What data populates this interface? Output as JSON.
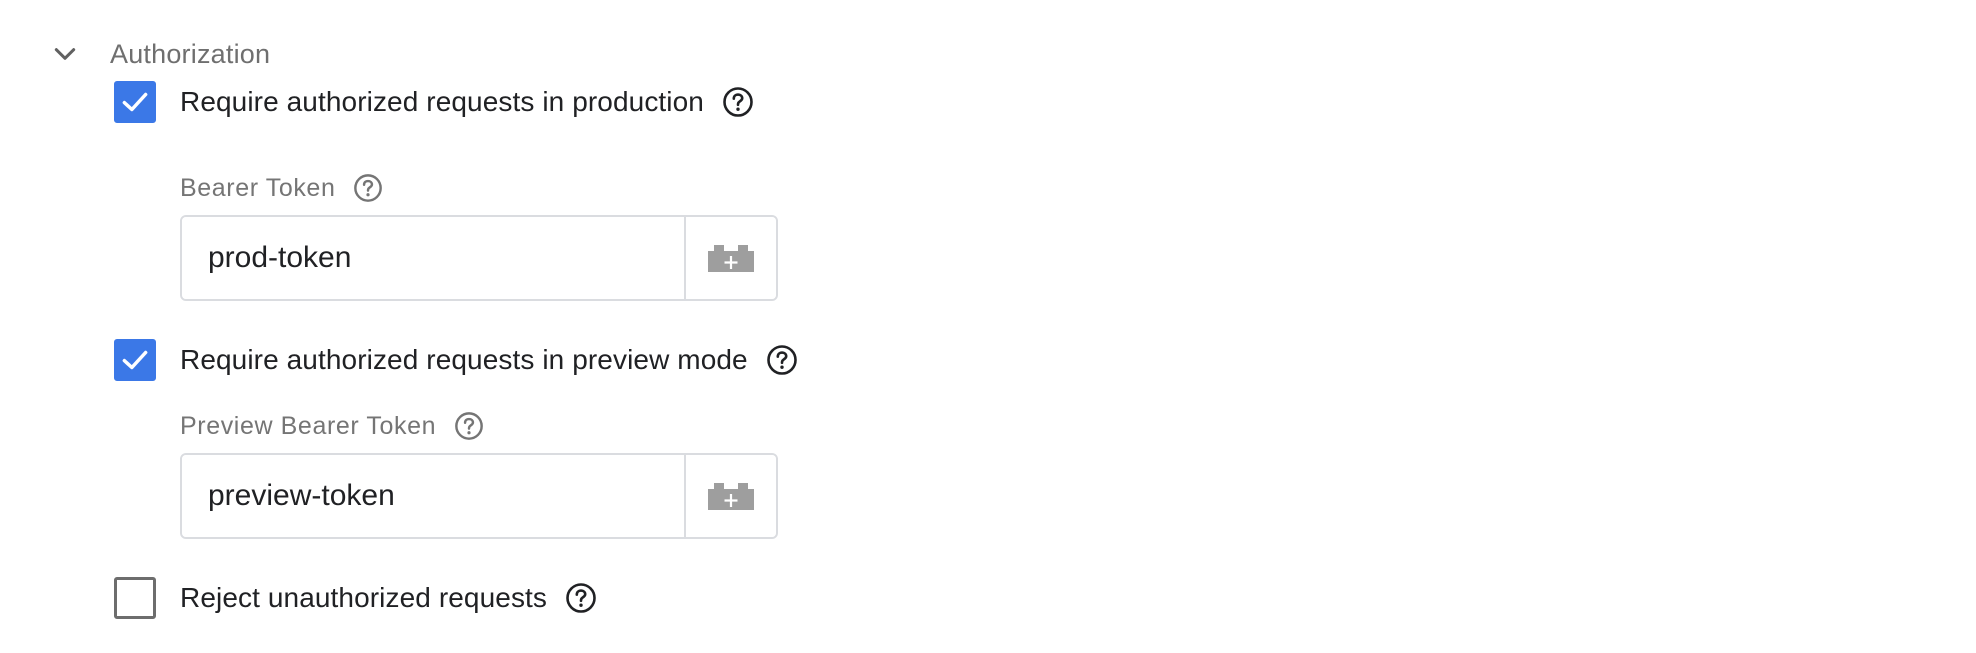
{
  "section": {
    "title": "Authorization",
    "expanded": true,
    "toggle_icon": "chevron-down-icon"
  },
  "options": {
    "production": {
      "label": "Require authorized requests in production",
      "checked": true,
      "field": {
        "label": "Bearer Token",
        "value": "prod-token"
      }
    },
    "preview": {
      "label": "Require authorized requests in preview mode",
      "checked": true,
      "field": {
        "label": "Preview Bearer Token",
        "value": "preview-token"
      }
    },
    "reject": {
      "label": "Reject unauthorized requests",
      "checked": false
    }
  },
  "icons": {
    "help": "help-circle-icon",
    "variable": "add-variable-brick-icon",
    "check": "checkmark-icon"
  },
  "colors": {
    "checkbox_checked": "#3b78e7",
    "checkbox_unchecked_border": "#6d6d6d",
    "input_border": "#dadce0",
    "variable_icon": "#9e9e9e",
    "header_text": "#6f6f6f",
    "label_text": "#757575"
  }
}
